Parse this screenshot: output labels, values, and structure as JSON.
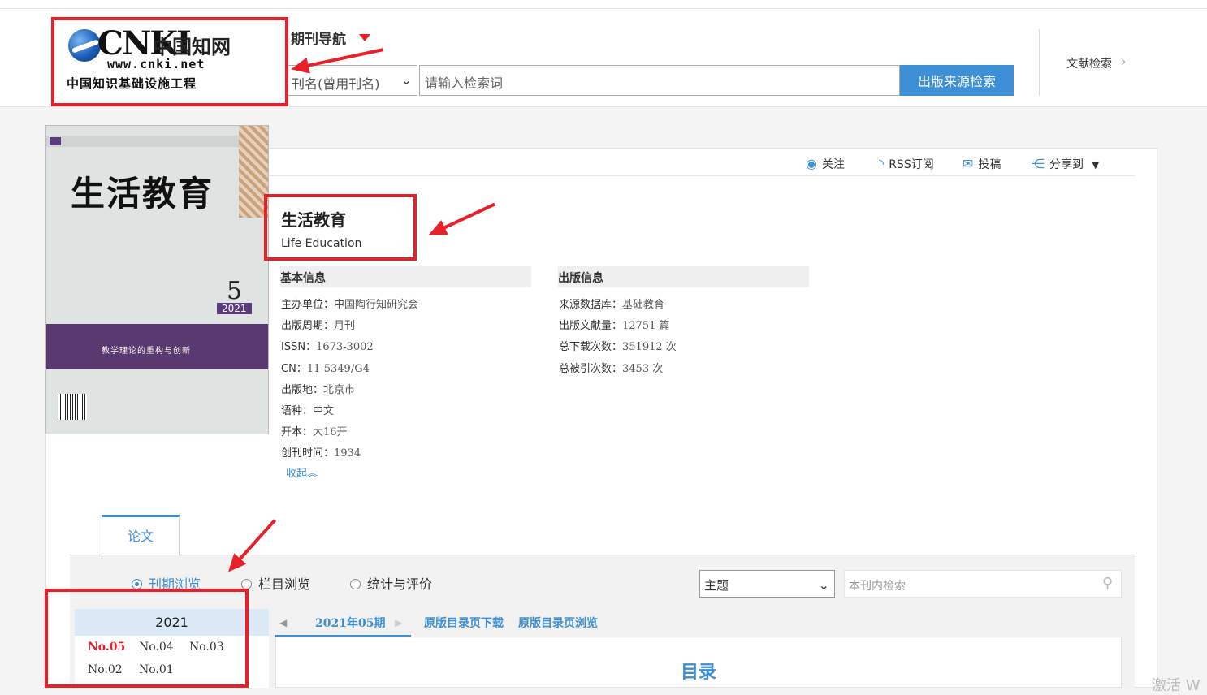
{
  "header": {
    "logo": {
      "brand": "CNKI",
      "brand_cn": "中国知网",
      "url": "www.cnki.net",
      "subtitle": "中国知识基础设施工程"
    },
    "nav_label": "期刊导航",
    "search_field_select": "刊名(曾用刊名)",
    "search_placeholder": "请输入检索词",
    "search_button": "出版来源检索",
    "doc_search_link": "文献检索"
  },
  "cover": {
    "title": "生活教育",
    "issue_num": "5",
    "year": "2021",
    "feature": "教学理论的重构与创新"
  },
  "actions": {
    "follow": "关注",
    "rss": "RSS订阅",
    "submit": "投稿",
    "share": "分享到"
  },
  "journal": {
    "title_cn": "生活教育",
    "title_en": "Life Education"
  },
  "basic_info": {
    "heading": "基本信息",
    "rows": [
      {
        "k": "主办单位：",
        "v": "中国陶行知研究会"
      },
      {
        "k": "出版周期：",
        "v": "月刊"
      },
      {
        "k": "ISSN：",
        "v": "1673-3002"
      },
      {
        "k": "CN：",
        "v": "11-5349/G4"
      },
      {
        "k": "出版地：",
        "v": "北京市"
      },
      {
        "k": "语种：",
        "v": "中文"
      },
      {
        "k": "开本：",
        "v": "大16开"
      },
      {
        "k": "创刊时间：",
        "v": "1934"
      }
    ],
    "collapse": "收起︽"
  },
  "pub_info": {
    "heading": "出版信息",
    "rows": [
      {
        "k": "来源数据库：",
        "v": "基础教育"
      },
      {
        "k": "出版文献量：",
        "v": "12751 篇"
      },
      {
        "k": "总下载次数：",
        "v": "351912 次"
      },
      {
        "k": "总被引次数：",
        "v": "3453 次"
      }
    ]
  },
  "tabs": {
    "paper": "论文"
  },
  "browse": {
    "modes": [
      "刊期浏览",
      "栏目浏览",
      "统计与评价"
    ],
    "filter_select": "主题",
    "inner_search_placeholder": "本刊内检索"
  },
  "issues": {
    "year": "2021",
    "list": [
      "No.05",
      "No.04",
      "No.03",
      "No.02",
      "No.01"
    ]
  },
  "toc": {
    "current_issue": "2021年05期",
    "download_link": "原版目录页下载",
    "browse_link": "原版目录页浏览",
    "title": "目录"
  },
  "watermark": "激活 W",
  "colors": {
    "accent": "#3d8fd6",
    "annotation_red": "#e8202a"
  }
}
